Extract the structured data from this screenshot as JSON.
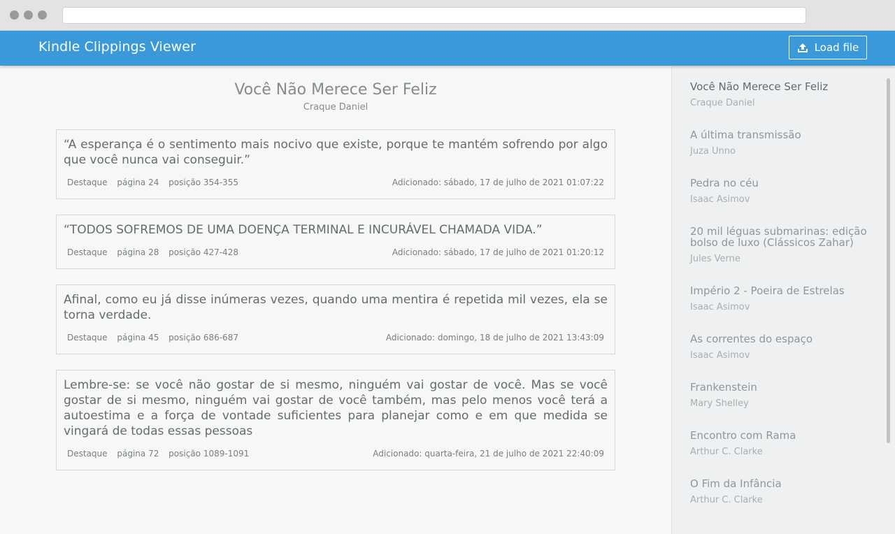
{
  "app": {
    "title": "Kindle Clippings Viewer",
    "load_button": "Load file"
  },
  "book": {
    "title": "Você Não Merece Ser Feliz",
    "author": "Craque Daniel"
  },
  "clippings": [
    {
      "text": "“A esperança é o sentimento mais nocivo que existe, porque te mantém sofrendo por algo que você nunca vai conseguir.”",
      "type": "Destaque",
      "page": "página 24",
      "position": "posição 354-355",
      "added": "Adicionado: sábado, 17 de julho de 2021 01:07:22"
    },
    {
      "text": "“TODOS SOFREMOS DE UMA DOENÇA TERMINAL E INCURÁVEL CHAMADA VIDA.”",
      "type": "Destaque",
      "page": "página 28",
      "position": "posição 427-428",
      "added": "Adicionado: sábado, 17 de julho de 2021 01:20:12"
    },
    {
      "text": "Afinal, como eu já disse inúmeras vezes, quando uma mentira é repetida mil vezes, ela se torna verdade.",
      "type": "Destaque",
      "page": "página 45",
      "position": "posição 686-687",
      "added": "Adicionado: domingo, 18 de julho de 2021 13:43:09"
    },
    {
      "text": "Lembre-se: se você não gostar de si mesmo, ninguém vai gostar de você. Mas se você gostar de si mesmo, ninguém vai gostar de você também, mas pelo menos você terá a autoestima e a força de vontade suficientes para planejar como e em que medida se vingará de todas essas pessoas",
      "type": "Destaque",
      "page": "página 72",
      "position": "posição 1089-1091",
      "added": "Adicionado: quarta-feira, 21 de julho de 2021 22:40:09"
    }
  ],
  "sidebar": {
    "books": [
      {
        "title": "Você Não Merece Ser Feliz",
        "author": "Craque Daniel"
      },
      {
        "title": "A última transmissão",
        "author": "Juza Unno"
      },
      {
        "title": "Pedra no céu",
        "author": "Isaac Asimov"
      },
      {
        "title": "20 mil léguas submarinas: edição bolso de luxo (Clássicos Zahar)",
        "author": "Jules Verne"
      },
      {
        "title": "Império 2 - Poeira de Estrelas",
        "author": "Isaac Asimov"
      },
      {
        "title": "As correntes do espaço",
        "author": "Isaac Asimov"
      },
      {
        "title": "Frankenstein",
        "author": "Mary Shelley"
      },
      {
        "title": "Encontro com Rama",
        "author": "Arthur C. Clarke"
      },
      {
        "title": "O Fim da Infância",
        "author": "Arthur C. Clarke"
      }
    ]
  },
  "colors": {
    "header": "#3a9ad9",
    "background": "#f7f7f7",
    "sidebar": "#eef0f1"
  },
  "icons": {
    "load": "upload-icon"
  }
}
